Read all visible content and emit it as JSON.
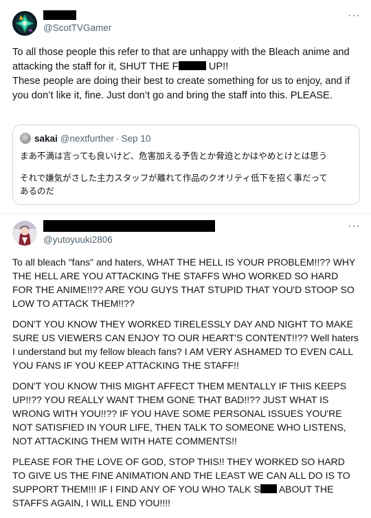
{
  "tweet1": {
    "handle": "@ScotTVGamer",
    "text_a": "To all those people this refer to that are unhappy with the Bleach anime and attacking the staff for it, SHUT THE F",
    "text_b": " UP!!\nThese people are doing their best to create something for us to enjoy, and if you don’t like it, fine. Just don’t go and bring the staff into this. PLEASE.",
    "more_label": "···",
    "quote": {
      "name": "sakai",
      "handle": "@nextfurther",
      "separator": "·",
      "date": "Sep 10",
      "line1": "まあ不満は言っても良いけど、危害加える予告とか脅迫とかはやめとけとは思う",
      "line2": "それで嫌気がさした主力スタッフが離れて作品のクオリティ低下を招く事だって",
      "line3": "あるのだ"
    }
  },
  "tweet2": {
    "handle": "@yutoyuuki2806",
    "more_label": "···",
    "para1": "To all bleach \"fans\" and haters, WHAT THE HELL IS YOUR PROBLEM!!?? WHY THE HELL ARE YOU ATTACKING THE STAFFS WHO WORKED SO HARD FOR THE ANIME!!?? ARE YOU GUYS THAT STUPID THAT YOU'D STOOP SO LOW TO ATTACK THEM!!??",
    "para2": "DON'T YOU KNOW THEY WORKED TIRELESSLY DAY AND NIGHT TO MAKE SURE US VIEWERS CAN ENJOY TO OUR HEART'S CONTENT!!?? Well haters I understand but my fellow bleach fans? I AM VERY ASHAMED TO EVEN CALL YOU FANS IF YOU KEEP ATTACKING THE STAFF!!",
    "para3": "DON'T YOU KNOW THIS MIGHT AFFECT THEM MENTALLY IF THIS KEEPS UP!!?? YOU REALLY WANT THEM GONE THAT BAD!!?? JUST WHAT IS WRONG WITH YOU!!?? IF YOU HAVE SOME PERSONAL ISSUES YOU'RE NOT SATISFIED IN YOUR LIFE, THEN TALK TO SOMEONE WHO LISTENS, NOT ATTACKING THEM WITH HATE COMMENTS!!",
    "para4_a": "PLEASE FOR THE LOVE OF GOD, STOP THIS!! THEY WORKED SO HARD TO GIVE US THE FINE ANIMATION AND THE LEAST WE CAN ALL DO IS TO SUPPORT THEM!!! IF I FIND ANY OF YOU WHO TALK S",
    "para4_b": " ABOUT THE STAFFS AGAIN, I WILL END YOU!!!!"
  },
  "colors": {
    "text": "#0f1419",
    "secondary": "#536471",
    "border": "#cfd9de",
    "redaction": "#000000"
  }
}
